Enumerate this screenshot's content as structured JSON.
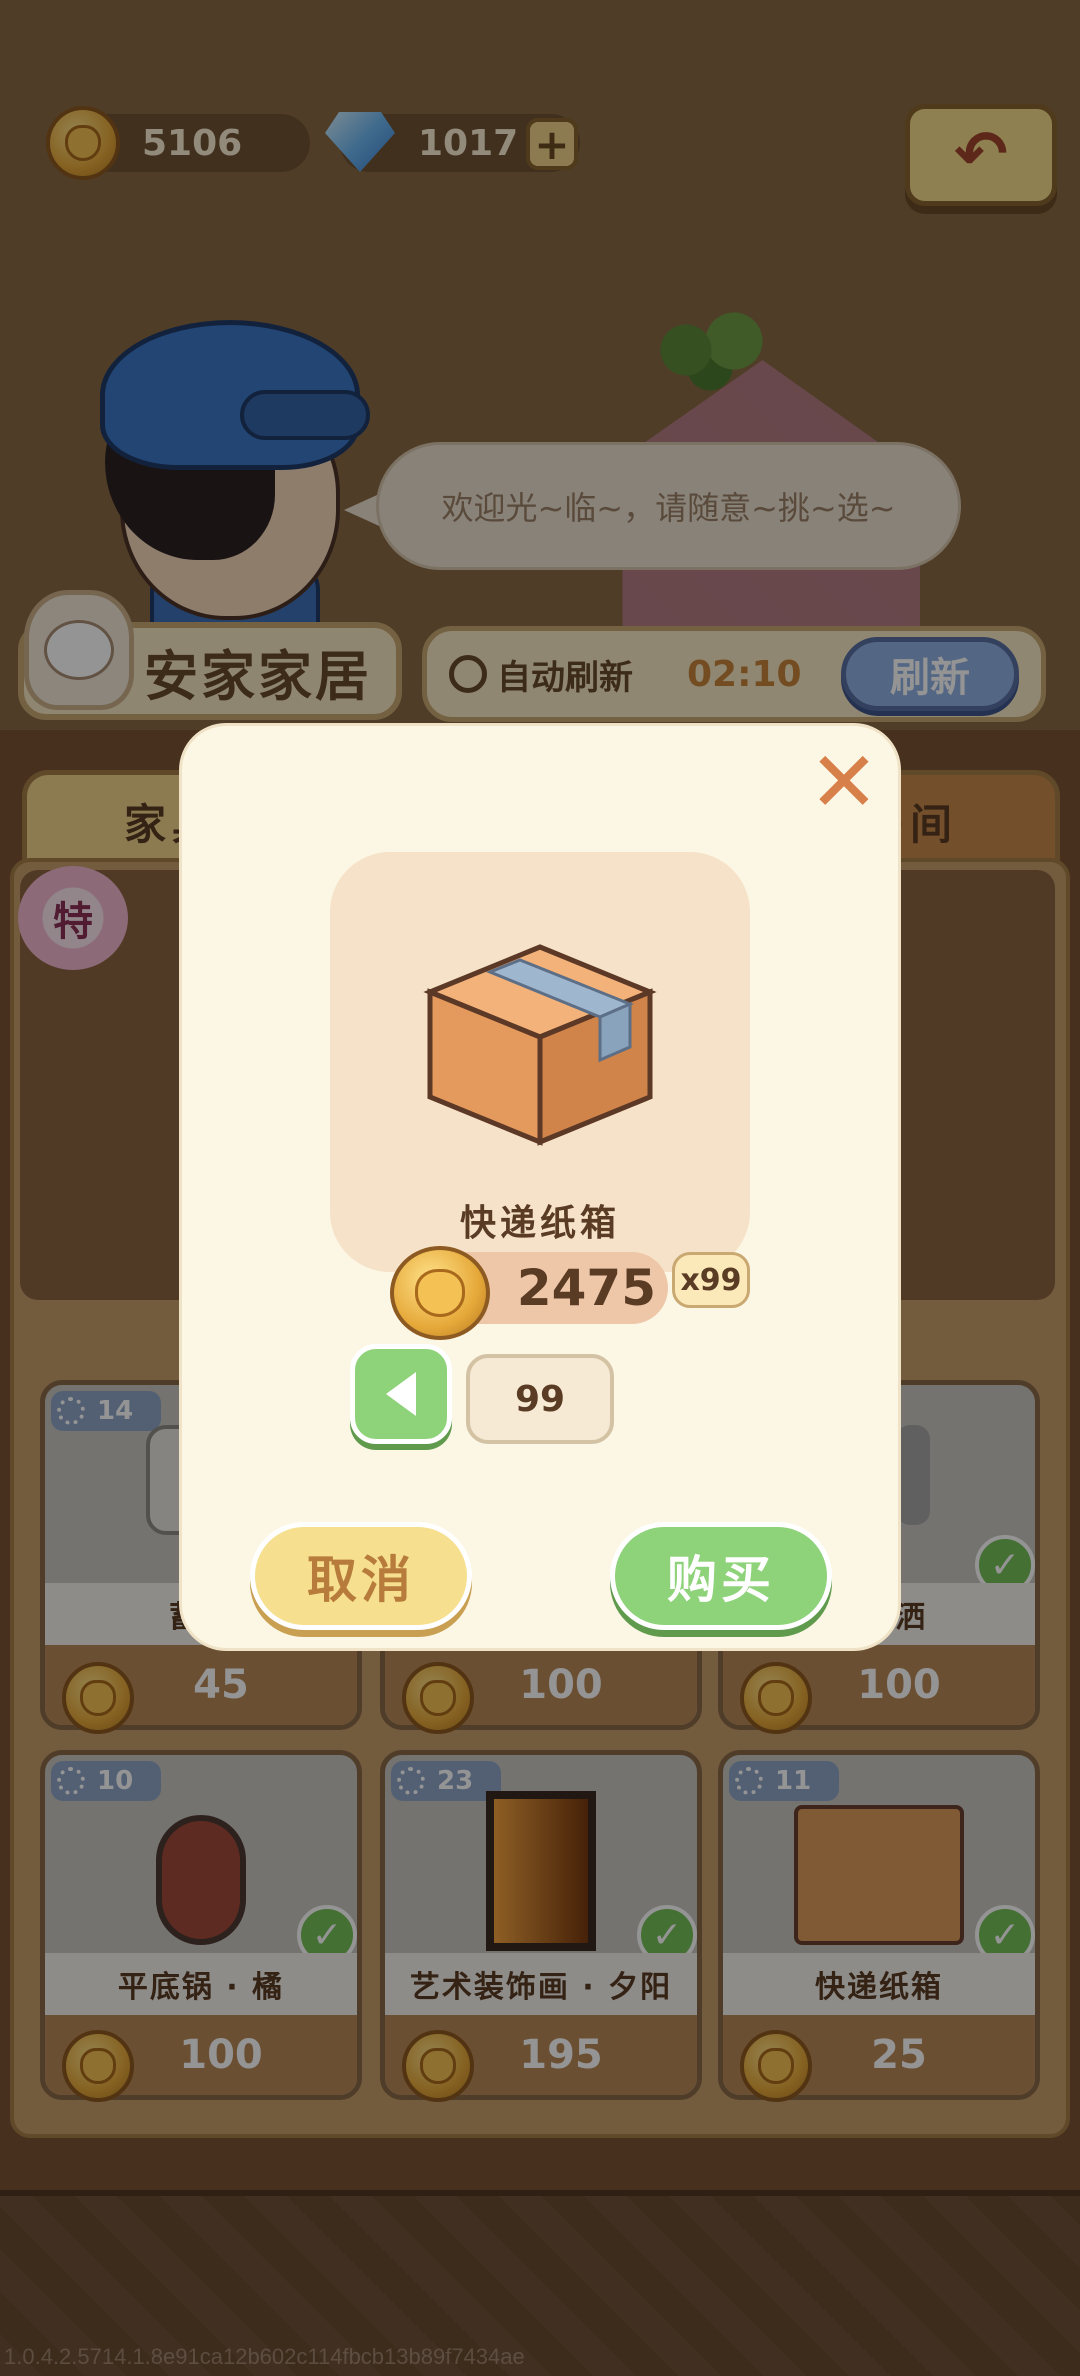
{
  "currency": {
    "coins": "5106",
    "gems": "1017",
    "add_gems_icon": "plus-icon",
    "back_icon": "undo-arrow-icon"
  },
  "npc": {
    "speech": "欢迎光~临~，请随意~挑~选~"
  },
  "shop": {
    "name": "安家家居",
    "auto_refresh_label": "自动刷新",
    "refresh_countdown": "02:10",
    "refresh_button": "刷新",
    "tabs": [
      "家具",
      "房间"
    ],
    "special_badge": "特"
  },
  "items": [
    {
      "stock": "14",
      "name": "蓄水",
      "price": "45",
      "owned": false
    },
    {
      "stock": "",
      "name": "",
      "price": "100",
      "owned": false
    },
    {
      "stock": "",
      "name": "式花洒",
      "price": "100",
      "owned": true
    },
    {
      "stock": "10",
      "name": "平底锅 · 橘",
      "price": "100",
      "owned": true
    },
    {
      "stock": "23",
      "name": "艺术装饰画 · 夕阳",
      "price": "195",
      "owned": true
    },
    {
      "stock": "11",
      "name": "快递纸箱",
      "price": "25",
      "owned": true
    }
  ],
  "purchase_dialog": {
    "item_name": "快递纸箱",
    "total_price": "2475",
    "stock_label": "x99",
    "quantity": "99",
    "cancel_button": "取消",
    "buy_button": "购买",
    "close_icon": "close-icon"
  },
  "build_id": "1.0.4.2.5714.1.8e91ca12b602c114fbcb13b89f7434ae",
  "colors": {
    "coin": "#e6a93a",
    "buy_green": "#8ed27a",
    "cancel_yellow": "#f6df8e",
    "refresh_blue": "#8fb0e2",
    "close_orange": "#d8804a"
  }
}
